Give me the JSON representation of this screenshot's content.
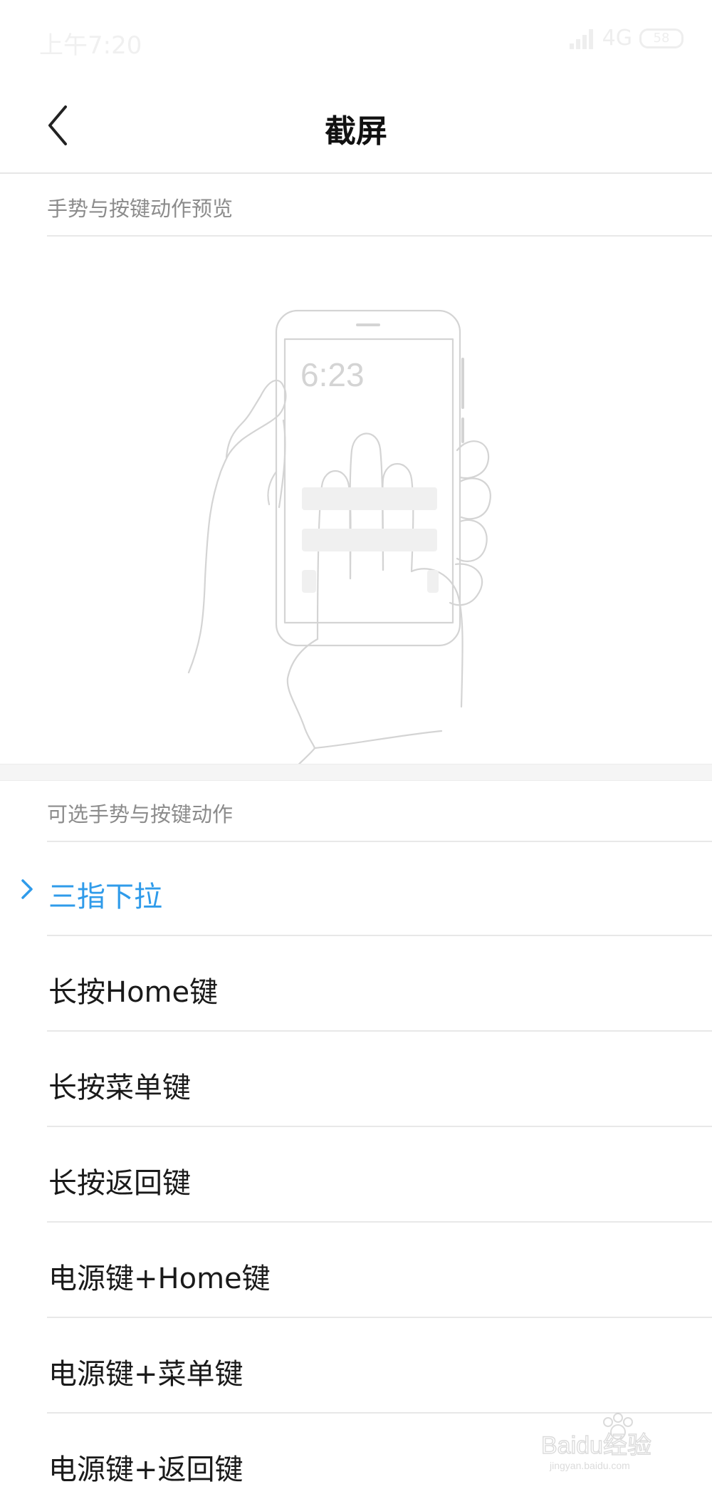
{
  "status": {
    "time": "上午7:20",
    "network": "4G",
    "battery": "58"
  },
  "header": {
    "title": "截屏"
  },
  "preview": {
    "section_label": "手势与按键动作预览",
    "phone_clock": "6:23"
  },
  "options": {
    "section_label": "可选手势与按键动作",
    "items": [
      {
        "label": "三指下拉",
        "selected": true
      },
      {
        "label": "长按Home键",
        "selected": false
      },
      {
        "label": "长按菜单键",
        "selected": false
      },
      {
        "label": "长按返回键",
        "selected": false
      },
      {
        "label": "电源键+Home键",
        "selected": false
      },
      {
        "label": "电源键+菜单键",
        "selected": false
      },
      {
        "label": "电源键+返回键",
        "selected": false
      }
    ]
  },
  "watermark": {
    "text": "Baidu经验",
    "subtext": "jingyan.baidu.com"
  },
  "colors": {
    "accent": "#2f9bea",
    "text": "#1a1a1a",
    "muted": "#8c8c8c",
    "divider": "#e8e8e8"
  }
}
